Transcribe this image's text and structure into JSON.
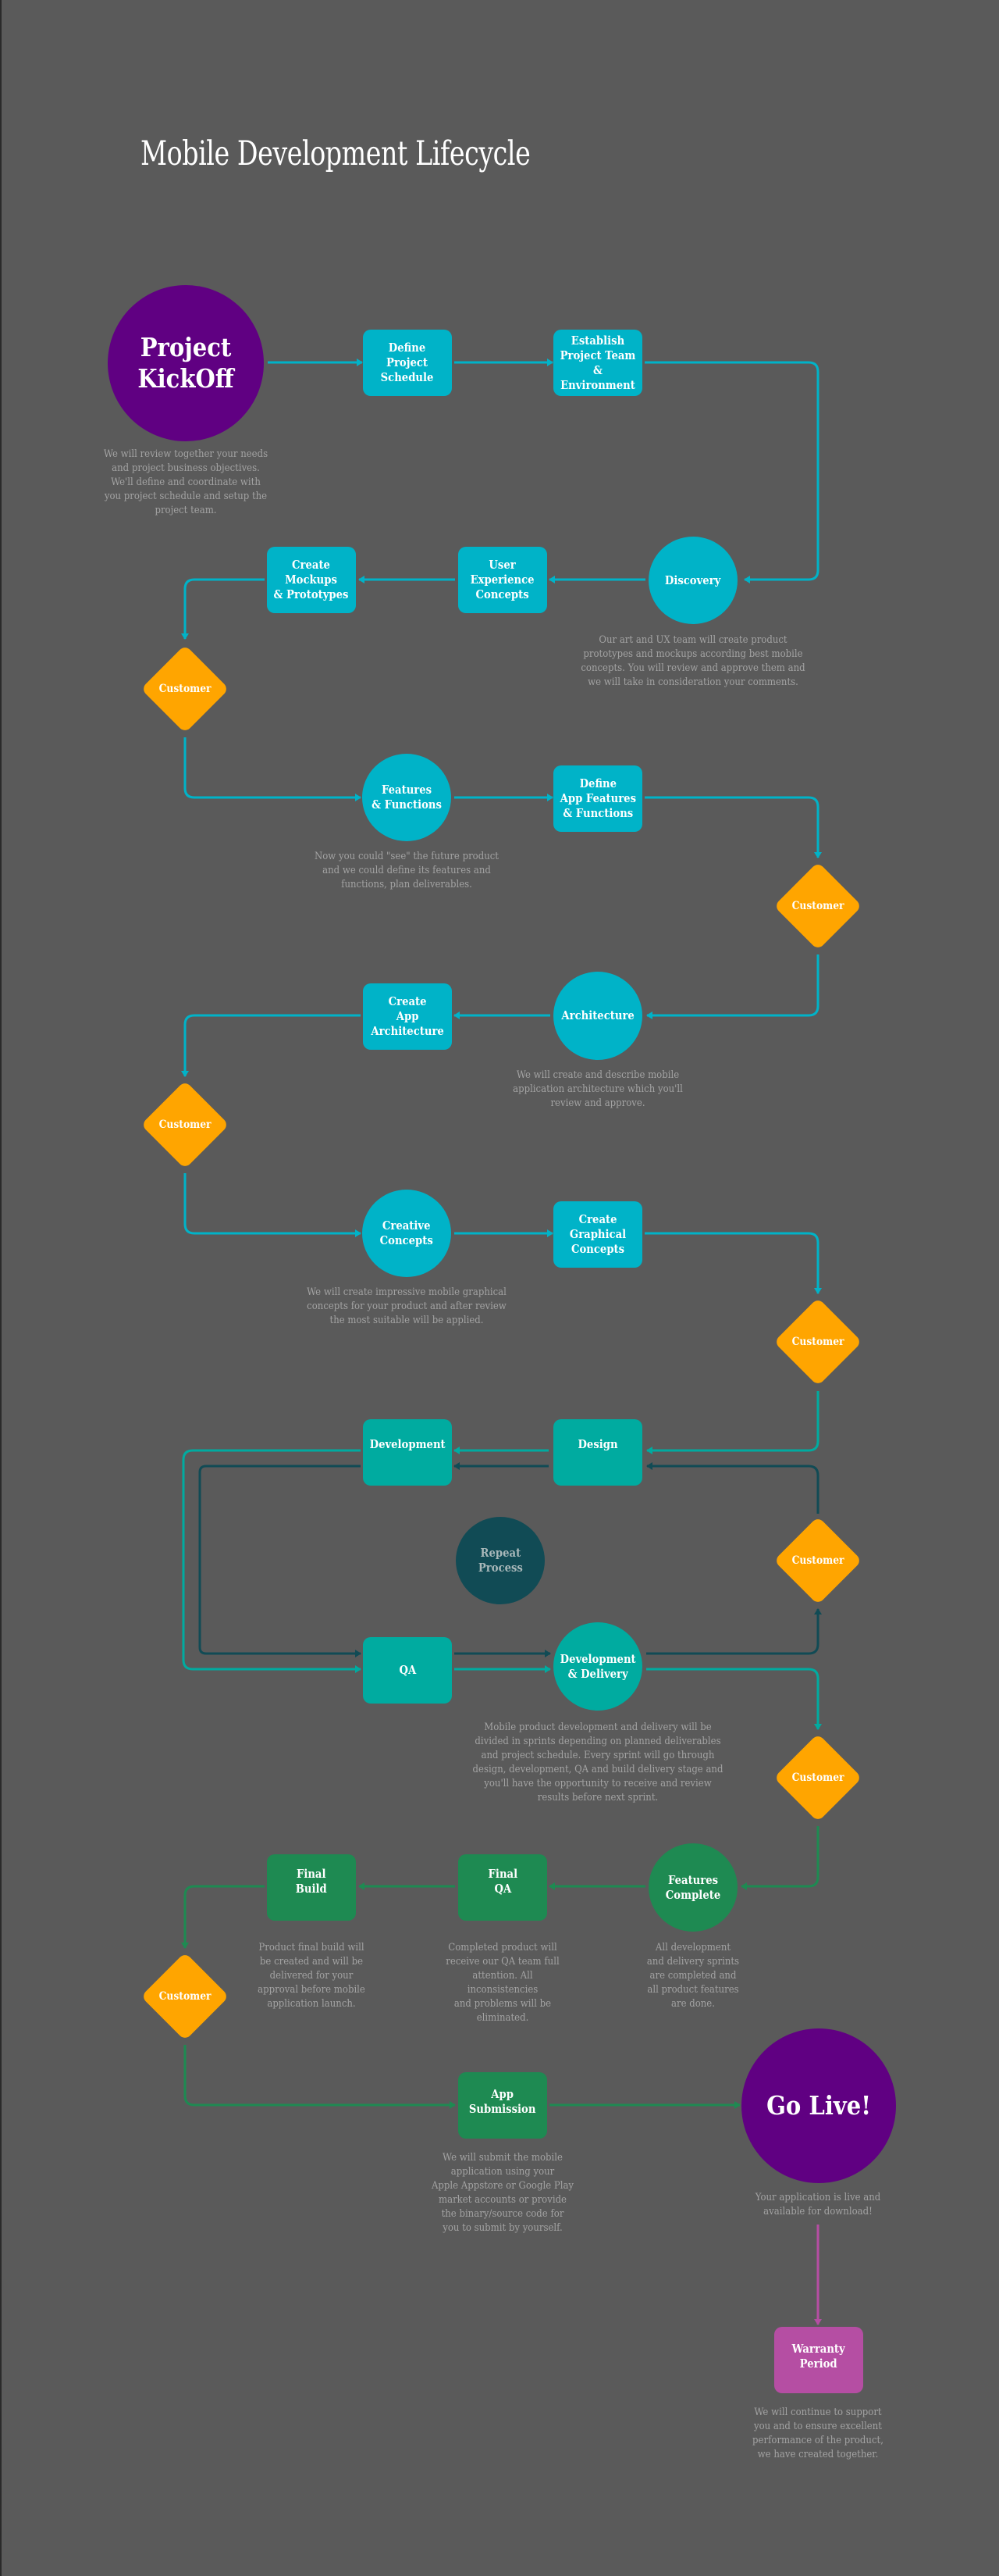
{
  "title": "Mobile Development Lifecycle",
  "colors": {
    "background": "#5a5a5a",
    "cyan": "#00b3c8",
    "teal": "#00aba0",
    "dark_teal": "#114b55",
    "green": "#1e8a52",
    "purple": "#600082",
    "magenta": "#b54ea3",
    "customer_orange": "#ffa500",
    "description_text": "#a3a3a3"
  },
  "nodes": {
    "kickoff": {
      "label": "Project\nKickOff",
      "shape": "circle"
    },
    "define_schedule": {
      "label": "Define\nProject\nSchedule",
      "shape": "box"
    },
    "establish_team": {
      "label": "Establish\nProject Team\n& Environment",
      "shape": "box"
    },
    "discovery": {
      "label": "Discovery",
      "shape": "circle"
    },
    "ux_concepts": {
      "label": "User\nExperience\nConcepts",
      "shape": "box"
    },
    "mockups": {
      "label": "Create\nMockups\n& Prototypes",
      "shape": "box"
    },
    "customer_1": {
      "label": "Customer",
      "shape": "diamond"
    },
    "features_functions": {
      "label": "Features\n& Functions",
      "shape": "circle"
    },
    "define_app_features": {
      "label": "Define\nApp Features\n& Functions",
      "shape": "box"
    },
    "customer_2": {
      "label": "Customer",
      "shape": "diamond"
    },
    "architecture": {
      "label": "Architecture",
      "shape": "circle"
    },
    "create_app_arch": {
      "label": "Create\nApp\nArchitecture",
      "shape": "box"
    },
    "customer_3": {
      "label": "Customer",
      "shape": "diamond"
    },
    "creative_concepts": {
      "label": "Creative\nConcepts",
      "shape": "circle"
    },
    "graphical_concepts": {
      "label": "Create\nGraphical\nConcepts",
      "shape": "box"
    },
    "customer_4": {
      "label": "Customer",
      "shape": "diamond"
    },
    "design": {
      "label": "Design",
      "shape": "box"
    },
    "development": {
      "label": "Development",
      "shape": "box"
    },
    "repeat_process": {
      "label": "Repeat\nProcess",
      "shape": "circle"
    },
    "customer_5": {
      "label": "Customer",
      "shape": "diamond"
    },
    "qa": {
      "label": "QA",
      "shape": "box"
    },
    "dev_delivery": {
      "label": "Development\n& Delivery",
      "shape": "circle"
    },
    "customer_6": {
      "label": "Customer",
      "shape": "diamond"
    },
    "features_complete": {
      "label": "Features\nComplete",
      "shape": "circle"
    },
    "final_qa": {
      "label": "Final\nQA",
      "shape": "box"
    },
    "final_build": {
      "label": "Final\nBuild",
      "shape": "box"
    },
    "customer_7": {
      "label": "Customer",
      "shape": "diamond"
    },
    "app_submission": {
      "label": "App\nSubmission",
      "shape": "box"
    },
    "go_live": {
      "label": "Go Live!",
      "shape": "circle"
    },
    "warranty": {
      "label": "Warranty\nPeriod",
      "shape": "box"
    }
  },
  "descriptions": {
    "kickoff": "We will review together your needs\nand project business objectives.\nWe'll define and coordinate with\nyou project schedule and setup the\nproject team.",
    "discovery": "Our art and UX team will create product\nprototypes and mockups according best mobile\nconcepts. You will review and approve them and\nwe will take in consideration your comments.",
    "features_functions": "Now you could \"see\" the future product\nand we could define its features and\nfunctions, plan deliverables.",
    "architecture": "We will create and describe mobile\napplication architecture which you'll\nreview and approve.",
    "creative_concepts": "We will create impressive mobile graphical\nconcepts for your product and after review\nthe most suitable will be applied.",
    "dev_delivery": "Mobile product development and delivery will be\ndivided in sprints depending on planned deliverables\nand project schedule. Every sprint will go through\ndesign, development, QA and build delivery stage and\nyou'll have the opportunity to receive and review\nresults before next sprint.",
    "final_build": "Product final build will\nbe created and will be\ndelivered for your\napproval before mobile\napplication launch.",
    "final_qa": "Completed product will\nreceive our QA team full\nattention. All inconsistencies\nand problems will be\neliminated.",
    "features_complete": "All development\nand delivery sprints\nare completed and\nall product features\nare done.",
    "app_submission": "We will submit the mobile\napplication using your\nApple Appstore or Google Play\nmarket accounts or provide\nthe binary/source code for\nyou to submit by yourself.",
    "go_live": "Your application is live and\navailable for download!",
    "warranty": "We will continue to support\nyou and to ensure excellent\nperformance of the product,\nwe have created together."
  },
  "connections": [
    {
      "from": "kickoff",
      "to": "define_schedule",
      "color": "cyan"
    },
    {
      "from": "define_schedule",
      "to": "establish_team",
      "color": "cyan"
    },
    {
      "from": "establish_team",
      "to": "discovery",
      "color": "cyan"
    },
    {
      "from": "discovery",
      "to": "ux_concepts",
      "color": "cyan"
    },
    {
      "from": "ux_concepts",
      "to": "mockups",
      "color": "cyan"
    },
    {
      "from": "mockups",
      "to": "customer_1",
      "color": "cyan"
    },
    {
      "from": "customer_1",
      "to": "features_functions",
      "color": "cyan"
    },
    {
      "from": "features_functions",
      "to": "define_app_features",
      "color": "cyan"
    },
    {
      "from": "define_app_features",
      "to": "customer_2",
      "color": "cyan"
    },
    {
      "from": "customer_2",
      "to": "architecture",
      "color": "cyan"
    },
    {
      "from": "architecture",
      "to": "create_app_arch",
      "color": "cyan"
    },
    {
      "from": "create_app_arch",
      "to": "customer_3",
      "color": "cyan"
    },
    {
      "from": "customer_3",
      "to": "creative_concepts",
      "color": "cyan"
    },
    {
      "from": "creative_concepts",
      "to": "graphical_concepts",
      "color": "cyan"
    },
    {
      "from": "graphical_concepts",
      "to": "customer_4",
      "color": "cyan"
    },
    {
      "from": "customer_4",
      "to": "design",
      "color": "teal"
    },
    {
      "from": "design",
      "to": "development",
      "color": "teal"
    },
    {
      "from": "development",
      "to": "qa",
      "color": "teal"
    },
    {
      "from": "qa",
      "to": "dev_delivery",
      "color": "teal"
    },
    {
      "from": "dev_delivery",
      "to": "customer_6",
      "color": "teal"
    },
    {
      "from": "design",
      "to": "development",
      "color": "dark_teal"
    },
    {
      "from": "development",
      "to": "qa",
      "color": "dark_teal"
    },
    {
      "from": "qa",
      "to": "dev_delivery",
      "color": "dark_teal"
    },
    {
      "from": "dev_delivery",
      "to": "customer_5",
      "color": "dark_teal"
    },
    {
      "from": "customer_5",
      "to": "design",
      "color": "dark_teal"
    },
    {
      "from": "customer_6",
      "to": "features_complete",
      "color": "green"
    },
    {
      "from": "features_complete",
      "to": "final_qa",
      "color": "green"
    },
    {
      "from": "final_qa",
      "to": "final_build",
      "color": "green"
    },
    {
      "from": "final_build",
      "to": "customer_7",
      "color": "green"
    },
    {
      "from": "customer_7",
      "to": "app_submission",
      "color": "green"
    },
    {
      "from": "app_submission",
      "to": "go_live",
      "color": "green"
    },
    {
      "from": "go_live",
      "to": "warranty",
      "color": "magenta"
    }
  ]
}
